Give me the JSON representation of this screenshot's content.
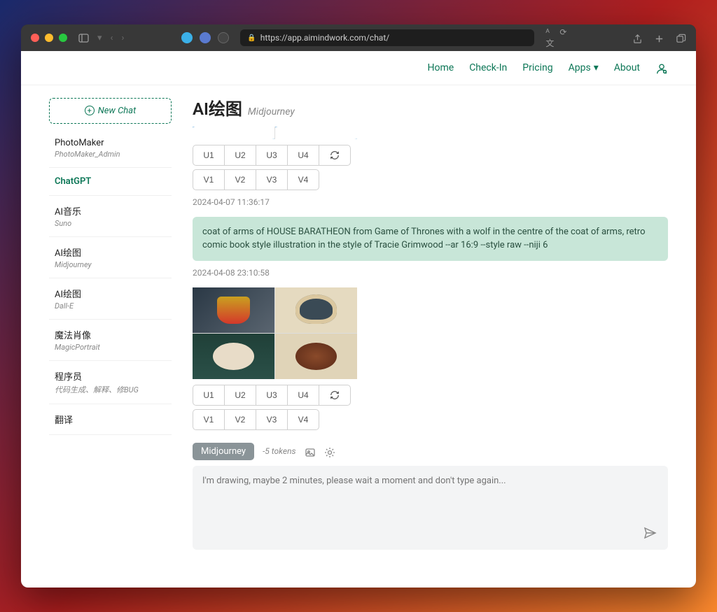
{
  "browser": {
    "url": "https://app.aimindwork.com/chat/"
  },
  "nav": {
    "home": "Home",
    "checkin": "Check-In",
    "pricing": "Pricing",
    "apps": "Apps",
    "about": "About"
  },
  "sidebar": {
    "new_chat": "New Chat",
    "items": [
      {
        "label": "PhotoMaker",
        "sub": "PhotoMaker_Admin"
      },
      {
        "label": "ChatGPT",
        "sub": ""
      },
      {
        "label": "AI音乐",
        "sub": "Suno"
      },
      {
        "label": "AI绘图",
        "sub": "Midjourney"
      },
      {
        "label": "AI绘图",
        "sub": "Dall-E"
      },
      {
        "label": "魔法肖像",
        "sub": "MagicPortrait"
      },
      {
        "label": "程序员",
        "sub": "代码生成、解释、修BUG"
      },
      {
        "label": "翻译",
        "sub": ""
      }
    ]
  },
  "page": {
    "title": "AI绘图",
    "subtitle": "Midjourney"
  },
  "messages": {
    "ts1": "2024-04-07 11:36:17",
    "prompt1": "coat of arms of HOUSE BARATHEON from Game of Thrones with a wolf in the centre of the coat of arms, retro comic book style illustration in the style of Tracie Grimwood --ar 16:9 --style raw --niji 6",
    "ts2": "2024-04-08 23:10:58",
    "buttons": {
      "u1": "U1",
      "u2": "U2",
      "u3": "U3",
      "u4": "U4",
      "v1": "V1",
      "v2": "V2",
      "v3": "V3",
      "v4": "V4"
    }
  },
  "composer": {
    "model": "Midjourney",
    "tokens": "-5 tokens",
    "placeholder": "I'm drawing, maybe 2 minutes, please wait a moment and don't type again..."
  }
}
